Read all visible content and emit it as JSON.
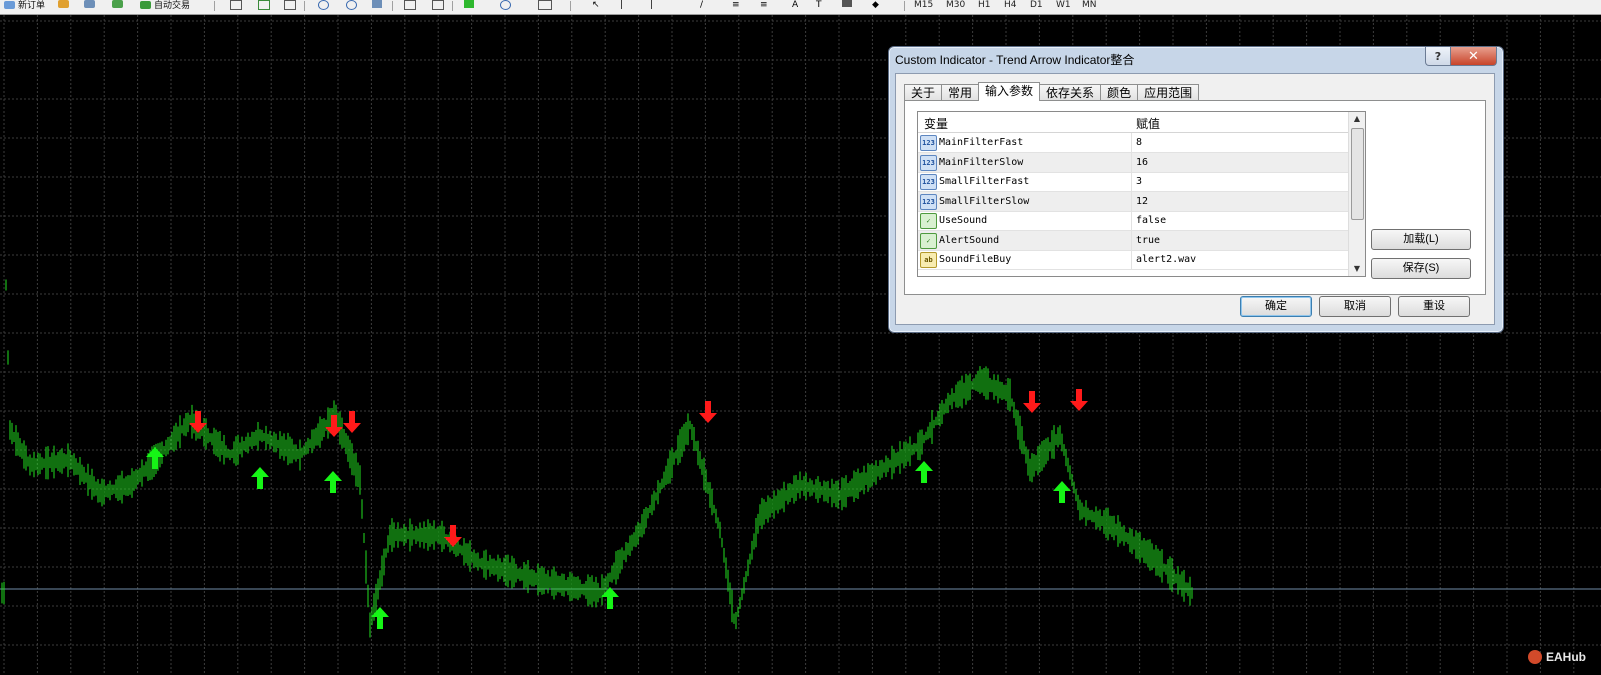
{
  "toolbar": {
    "new_order_label": "新订单",
    "auto_trading_label": "自动交易",
    "timeframes": [
      "M15",
      "M30",
      "H1",
      "H4",
      "D1",
      "W1",
      "MN"
    ]
  },
  "chart": {
    "background": "#000000",
    "grid_color": "#3c3c3c",
    "price_line_color": "#6f8da8",
    "bar_color": "#22e01f",
    "up_arrow_color": "#16f516",
    "down_arrow_color": "#ff1a1a",
    "up_arrows": 9,
    "down_arrows": 7
  },
  "dialog": {
    "title": "Custom Indicator - Trend Arrow Indicator整合",
    "help_label": "?",
    "close_label": "✕",
    "tabs": [
      {
        "label": "关于",
        "active": false
      },
      {
        "label": "常用",
        "active": false
      },
      {
        "label": "输入参数",
        "active": true
      },
      {
        "label": "依存关系",
        "active": false
      },
      {
        "label": "颜色",
        "active": false
      },
      {
        "label": "应用范围",
        "active": false
      }
    ],
    "grid": {
      "col_variable": "变量",
      "col_value": "赋值",
      "rows": [
        {
          "name": "MainFilterFast",
          "value": "8",
          "type": "number",
          "icon": "numeric-icon",
          "badge": "123"
        },
        {
          "name": "MainFilterSlow",
          "value": "16",
          "type": "number",
          "icon": "numeric-icon",
          "badge": "123"
        },
        {
          "name": "SmallFilterFast",
          "value": "3",
          "type": "number",
          "icon": "numeric-icon",
          "badge": "123"
        },
        {
          "name": "SmallFilterSlow",
          "value": "12",
          "type": "number",
          "icon": "numeric-icon",
          "badge": "123"
        },
        {
          "name": "UseSound",
          "value": "false",
          "type": "bool",
          "icon": "boolean-icon",
          "badge": "✓"
        },
        {
          "name": "AlertSound",
          "value": "true",
          "type": "bool",
          "icon": "boolean-icon",
          "badge": "✓"
        },
        {
          "name": "SoundFileBuy",
          "value": "alert2.wav",
          "type": "string",
          "icon": "string-icon",
          "badge": "ab"
        }
      ]
    },
    "load_label": "加载(L)",
    "save_label": "保存(S)",
    "ok_label": "确定",
    "cancel_label": "取消",
    "reset_label": "重设"
  },
  "watermark": "EAHub"
}
